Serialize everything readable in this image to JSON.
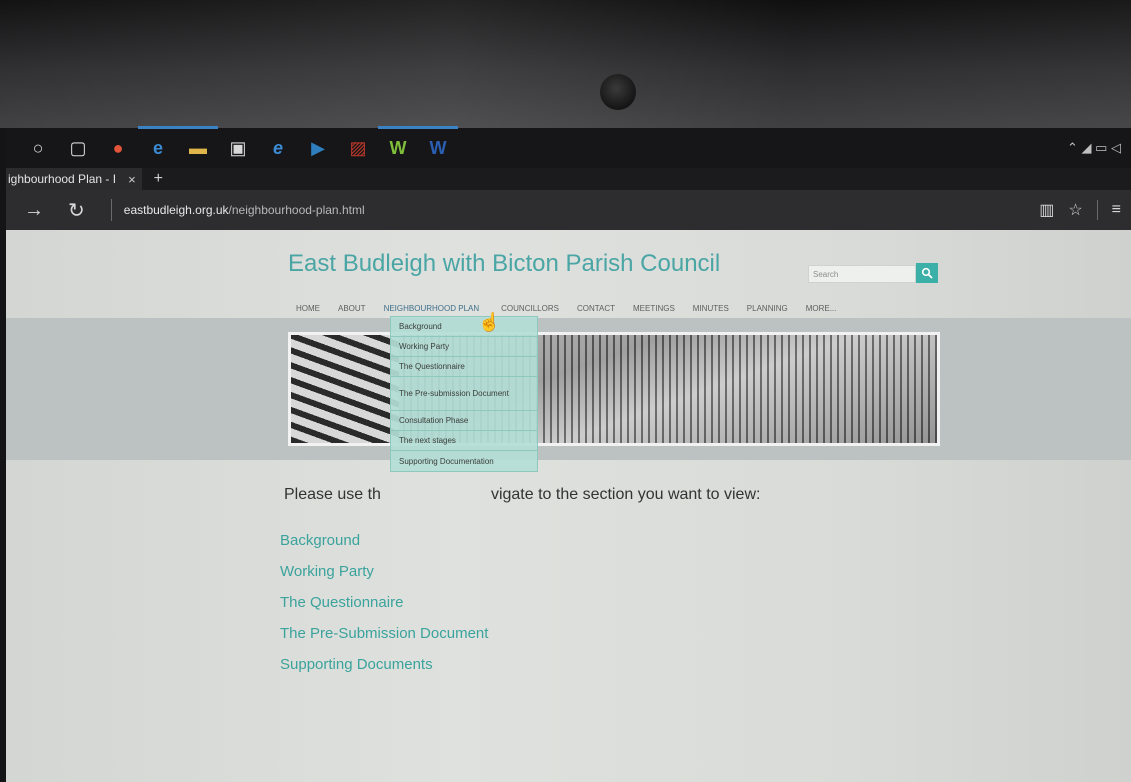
{
  "taskbar": {
    "icons": [
      {
        "name": "cortana-circle-icon",
        "glyph": "○"
      },
      {
        "name": "task-view-icon",
        "glyph": "▢"
      },
      {
        "name": "chrome-icon",
        "glyph": "●"
      },
      {
        "name": "edge-icon",
        "glyph": "e"
      },
      {
        "name": "file-explorer-icon",
        "glyph": "▬"
      },
      {
        "name": "store-icon",
        "glyph": "▣"
      },
      {
        "name": "internet-explorer-icon",
        "glyph": "e"
      },
      {
        "name": "media-player-icon",
        "glyph": "▶"
      },
      {
        "name": "photo-app-icon",
        "glyph": "▨"
      },
      {
        "name": "green-app-icon",
        "glyph": "W"
      },
      {
        "name": "word-icon",
        "glyph": "W"
      }
    ],
    "tray": "⌃ ◢ ▭ ◁"
  },
  "browser": {
    "tab_title": "ighbourhood Plan - I",
    "tab_close": "×",
    "new_tab": "+",
    "back": "→",
    "refresh": "↻",
    "url_host": "eastbudleigh.org.uk",
    "url_path": "/neighbourhood-plan.html",
    "reading_view": "▥",
    "favorite": "☆",
    "hub": "≡"
  },
  "site": {
    "title": "East Budleigh with Bicton Parish Council",
    "search_placeholder": "Search",
    "nav": [
      "HOME",
      "ABOUT",
      "NEIGHBOURHOOD PLAN",
      "COUNCILLORS",
      "CONTACT",
      "MEETINGS",
      "MINUTES",
      "PLANNING",
      "MORE..."
    ],
    "dropdown": [
      "Background",
      "Working Party",
      "The Questionnaire",
      "The Pre-submission Document",
      "Consultation Phase",
      "The next stages",
      "Supporting Documentation"
    ],
    "intro_left": "Please use th",
    "intro_right": "vigate to the section you want to view:",
    "links": [
      "Background",
      "Working Party",
      "The Questionnaire",
      "The Pre-Submission Document",
      "Supporting Documents"
    ]
  },
  "colors": {
    "accent": "#4aa5a5",
    "dropdown_bg": "#b4ded6"
  }
}
